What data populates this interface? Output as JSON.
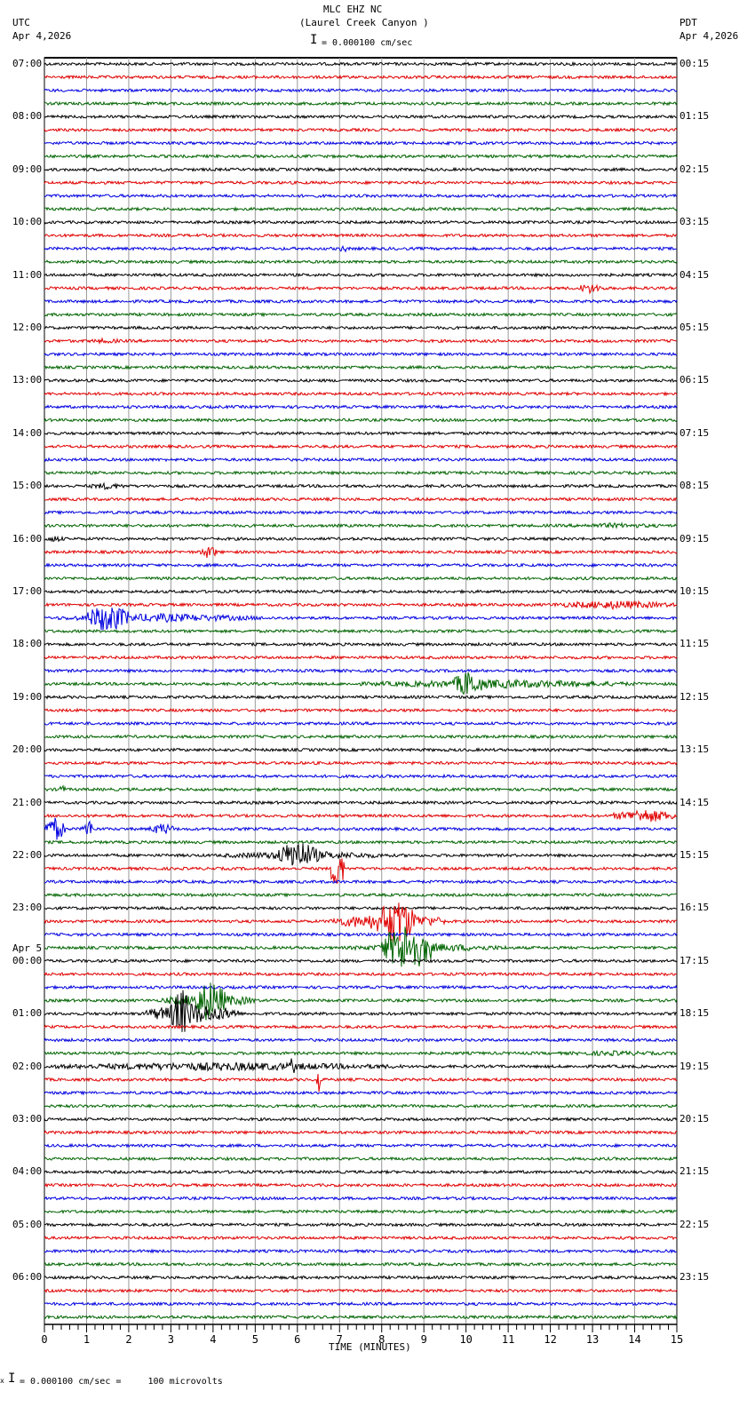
{
  "header": {
    "station": "MLC EHZ NC",
    "location": "(Laurel Creek Canyon )",
    "left_tz": "UTC",
    "left_date": "Apr 4,2026",
    "right_tz": "PDT",
    "right_date": "Apr 4,2026",
    "scale": "= 0.000100 cm/sec"
  },
  "footer": {
    "scale": "= 0.000100 cm/sec =     100 microvolts",
    "mark": "x"
  },
  "chart_data": {
    "type": "line",
    "title": "MLC EHZ NC (Laurel Creek Canyon )",
    "xlabel": "TIME (MINUTES)",
    "xlim": [
      0,
      15
    ],
    "x_ticks": [
      "0",
      "1",
      "2",
      "3",
      "4",
      "5",
      "6",
      "7",
      "8",
      "9",
      "10",
      "11",
      "12",
      "13",
      "14",
      "15"
    ],
    "traces_per_hour": 4,
    "trace_colors": [
      "#000000",
      "#e00000",
      "#0000e0",
      "#006400"
    ],
    "utc_labels": [
      "07:00",
      "08:00",
      "09:00",
      "10:00",
      "11:00",
      "12:00",
      "13:00",
      "14:00",
      "15:00",
      "16:00",
      "17:00",
      "18:00",
      "19:00",
      "20:00",
      "21:00",
      "22:00",
      "23:00",
      "00:00",
      "01:00",
      "02:00",
      "03:00",
      "04:00",
      "05:00",
      "06:00"
    ],
    "date_change_label": "Apr 5",
    "date_change_hour_index": 17,
    "pdt_labels": [
      "00:15",
      "01:15",
      "02:15",
      "03:15",
      "04:15",
      "05:15",
      "06:15",
      "07:15",
      "08:15",
      "09:15",
      "10:15",
      "11:15",
      "12:15",
      "13:15",
      "14:15",
      "15:15",
      "16:15",
      "17:15",
      "18:15",
      "19:15",
      "20:15",
      "21:15",
      "22:15",
      "23:15"
    ],
    "events": [
      {
        "trace": 14,
        "start": 7.0,
        "end": 7.2,
        "amp": 5
      },
      {
        "trace": 17,
        "start": 12.6,
        "end": 13.3,
        "amp": 6
      },
      {
        "trace": 21,
        "start": 0.9,
        "end": 2.0,
        "amp": 3
      },
      {
        "trace": 32,
        "start": 1.0,
        "end": 2.0,
        "amp": 4
      },
      {
        "trace": 35,
        "start": 12.0,
        "end": 15.0,
        "amp": 3
      },
      {
        "trace": 36,
        "start": 0.0,
        "end": 0.5,
        "amp": 4
      },
      {
        "trace": 37,
        "start": 3.7,
        "end": 4.1,
        "amp": 8
      },
      {
        "trace": 41,
        "start": 12.0,
        "end": 15.0,
        "amp": 5
      },
      {
        "trace": 42,
        "start": 0.3,
        "end": 5.2,
        "amp": 5
      },
      {
        "trace": 42,
        "start": 1.0,
        "end": 2.0,
        "amp": 18
      },
      {
        "trace": 47,
        "start": 7.5,
        "end": 14.0,
        "amp": 5
      },
      {
        "trace": 47,
        "start": 9.7,
        "end": 10.4,
        "amp": 16
      },
      {
        "trace": 55,
        "start": 0.3,
        "end": 0.5,
        "amp": 6
      },
      {
        "trace": 57,
        "start": 13.5,
        "end": 15.0,
        "amp": 8
      },
      {
        "trace": 58,
        "start": 0.0,
        "end": 0.5,
        "amp": 14
      },
      {
        "trace": 58,
        "start": 0.9,
        "end": 1.2,
        "amp": 11
      },
      {
        "trace": 58,
        "start": 2.5,
        "end": 3.1,
        "amp": 7
      },
      {
        "trace": 60,
        "start": 4.2,
        "end": 8.2,
        "amp": 5
      },
      {
        "trace": 60,
        "start": 5.5,
        "end": 6.5,
        "amp": 18
      },
      {
        "trace": 60,
        "start": 5.85,
        "end": 5.95,
        "amp": 30
      },
      {
        "trace": 61,
        "start": 6.8,
        "end": 7.1,
        "amp": 28
      },
      {
        "trace": 65,
        "start": 6.8,
        "end": 9.5,
        "amp": 10
      },
      {
        "trace": 65,
        "start": 7.9,
        "end": 8.8,
        "amp": 30
      },
      {
        "trace": 67,
        "start": 7.2,
        "end": 11.0,
        "amp": 5
      },
      {
        "trace": 67,
        "start": 8.0,
        "end": 9.2,
        "amp": 30
      },
      {
        "trace": 71,
        "start": 2.8,
        "end": 5.0,
        "amp": 8
      },
      {
        "trace": 71,
        "start": 3.5,
        "end": 4.3,
        "amp": 25
      },
      {
        "trace": 72,
        "start": 2.4,
        "end": 4.6,
        "amp": 12
      },
      {
        "trace": 72,
        "start": 3.0,
        "end": 3.5,
        "amp": 30
      },
      {
        "trace": 75,
        "start": 12.0,
        "end": 15.0,
        "amp": 3
      },
      {
        "trace": 76,
        "start": 0.0,
        "end": 8.5,
        "amp": 5
      },
      {
        "trace": 76,
        "start": 5.85,
        "end": 5.95,
        "amp": 20
      },
      {
        "trace": 77,
        "start": 6.45,
        "end": 6.55,
        "amp": 22
      }
    ]
  }
}
